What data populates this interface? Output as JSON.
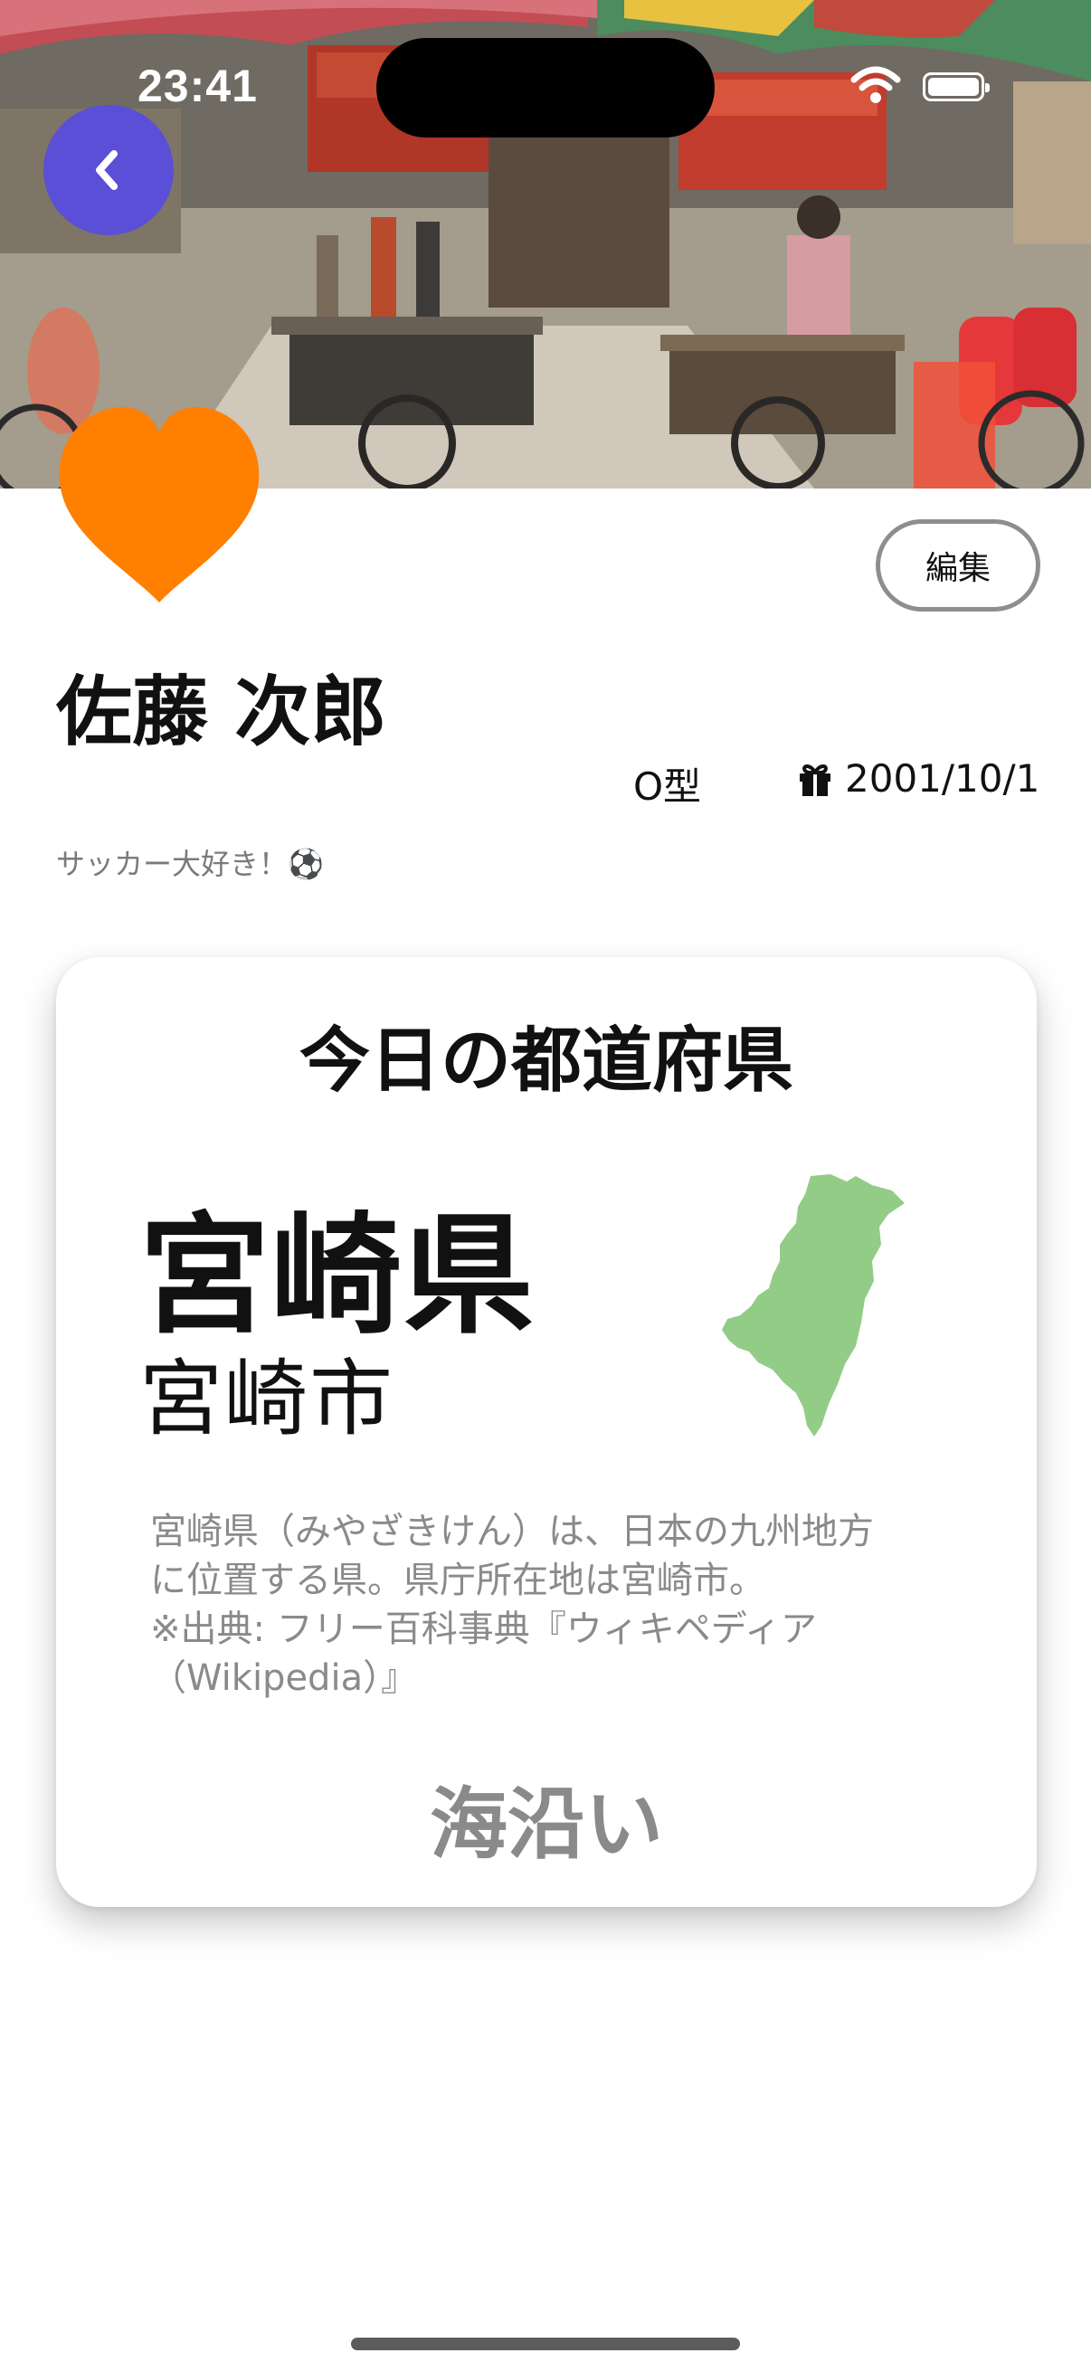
{
  "status_bar": {
    "time": "23:41"
  },
  "header": {
    "back_icon": "chevron-left-icon",
    "avatar_icon": "heart-icon",
    "edit_label": "編集"
  },
  "profile": {
    "name": "佐藤 次郎",
    "blood_type": "O型",
    "birthday_icon": "gift-icon",
    "birthday": "2001/10/1",
    "bio": "サッカー大好き！⚽"
  },
  "card": {
    "title": "今日の都道府県",
    "prefecture": "宮崎県",
    "capital": "宮崎市",
    "description_lines": [
      "宮崎県（みやざきけん）は、日本の九州地方",
      "に位置する県。県庁所在地は宮崎市。",
      "※出典: フリー百科事典『ウィキペディア",
      "（Wikipedia）』"
    ],
    "feature": "海沿い"
  },
  "colors": {
    "accent": "#5a4fd6",
    "avatar": "#ff7f00",
    "map_fill": "#93cc87",
    "muted_text": "#8a8a8a"
  }
}
